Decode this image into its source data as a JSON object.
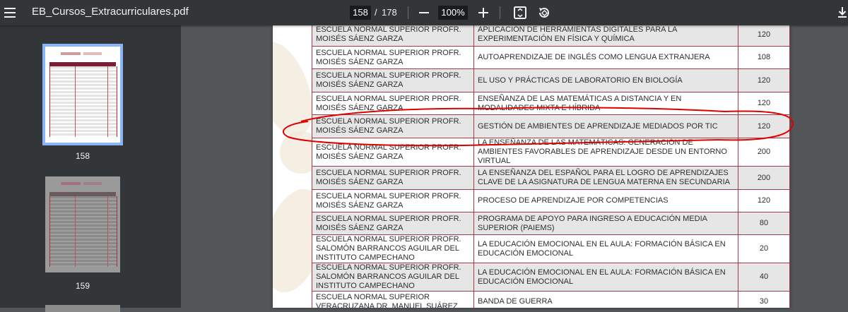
{
  "toolbar": {
    "menu_icon": "menu-icon",
    "title": "EB_Cursos_Extracurriculares.pdf",
    "current_page": "158",
    "page_separator": "/",
    "total_pages": "178",
    "zoom": "100%",
    "icons": [
      "zoom-out-icon",
      "zoom-in-icon",
      "fit-page-icon",
      "rotate-icon",
      "download-icon"
    ]
  },
  "sidebar": {
    "thumbnails": [
      {
        "label": "158",
        "selected": true
      },
      {
        "label": "159",
        "selected": false
      }
    ]
  },
  "table": {
    "rows": [
      {
        "school": "ESCUELA NORMAL SUPERIOR PROFR. MOISÉS SÁENZ GARZA",
        "course": "APLICACIÓN DE HERRAMIENTAS DIGITALES PARA LA EXPERIMENTACIÓN EN FÍSICA Y QUÍMICA",
        "hours": "120"
      },
      {
        "school": "ESCUELA NORMAL SUPERIOR PROFR. MOISÉS SÁENZ GARZA",
        "course": "AUTOAPRENDIZAJE DE INGLÉS COMO LENGUA EXTRANJERA",
        "hours": "108"
      },
      {
        "school": "ESCUELA NORMAL SUPERIOR PROFR. MOISÉS SÁENZ GARZA",
        "course": "EL USO Y PRÁCTICAS DE LABORATORIO EN BIOLOGÍA",
        "hours": "120"
      },
      {
        "school": "ESCUELA NORMAL SUPERIOR PROFR. MOISÉS SÁENZ GARZA",
        "course": "ENSEÑANZA DE LAS MATEMÁTICAS A DISTANCIA Y EN MODALIDADES MIXTA E HÍBRIDA",
        "hours": "120"
      },
      {
        "school": "ESCUELA NORMAL SUPERIOR PROFR. MOISÉS SÁENZ GARZA",
        "course": "GESTIÓN DE AMBIENTES DE APRENDIZAJE MEDIADOS POR TIC",
        "hours": "120"
      },
      {
        "school": "ESCUELA NORMAL SUPERIOR PROFR. MOISÉS SÁENZ GARZA",
        "course": "LA ENSEÑANZA DE LAS MATEMÁTICAS: GENERACIÓN DE AMBIENTES FAVORABLES DE APRENDIZAJE DESDE UN ENTORNO VIRTUAL",
        "hours": "200"
      },
      {
        "school": "ESCUELA NORMAL SUPERIOR PROFR. MOISÉS SÁENZ GARZA",
        "course": "LA ENSEÑANZA DEL ESPAÑOL PARA EL LOGRO DE APRENDIZAJES CLAVE DE LA ASIGNATURA DE LENGUA MATERNA EN SECUNDARIA",
        "hours": "200"
      },
      {
        "school": "ESCUELA NORMAL SUPERIOR PROFR. MOISÉS SÁENZ GARZA",
        "course": "PROCESO DE APRENDIZAJE POR COMPETENCIAS",
        "hours": "120"
      },
      {
        "school": "ESCUELA NORMAL SUPERIOR PROFR. MOISÉS SÁENZ GARZA",
        "course": "PROGRAMA DE APOYO PARA INGRESO A EDUCACIÓN MEDIA SUPERIOR (PAIEMS)",
        "hours": "80"
      },
      {
        "school": "ESCUELA NORMAL SUPERIOR PROFR. SALOMÓN BARRANCOS AGUILAR DEL INSTITUTO CAMPECHANO",
        "course": "LA EDUCACIÓN EMOCIONAL EN EL AULA: FORMACIÓN BÁSICA EN EDUCACIÓN EMOCIONAL",
        "hours": "20"
      },
      {
        "school": "ESCUELA NORMAL SUPERIOR PROFR. SALOMÓN BARRANCOS AGUILAR DEL INSTITUTO CAMPECHANO",
        "course": "LA EDUCACIÓN EMOCIONAL EN EL AULA: FORMACIÓN BÁSICA EN EDUCACIÓN EMOCIONAL",
        "hours": "40"
      },
      {
        "school": "ESCUELA NORMAL SUPERIOR VERACRUZANA DR. MANUEL SUÁREZ",
        "course": "BANDA DE GUERRA",
        "hours": "30"
      }
    ]
  },
  "colors": {
    "toolbar_bg": "#323639",
    "viewer_bg": "#525659",
    "table_border": "#a33a4a",
    "row_shade": "#e6e6e6",
    "highlight_ink": "#e00000",
    "thumb_selected": "#8ab4f8"
  }
}
